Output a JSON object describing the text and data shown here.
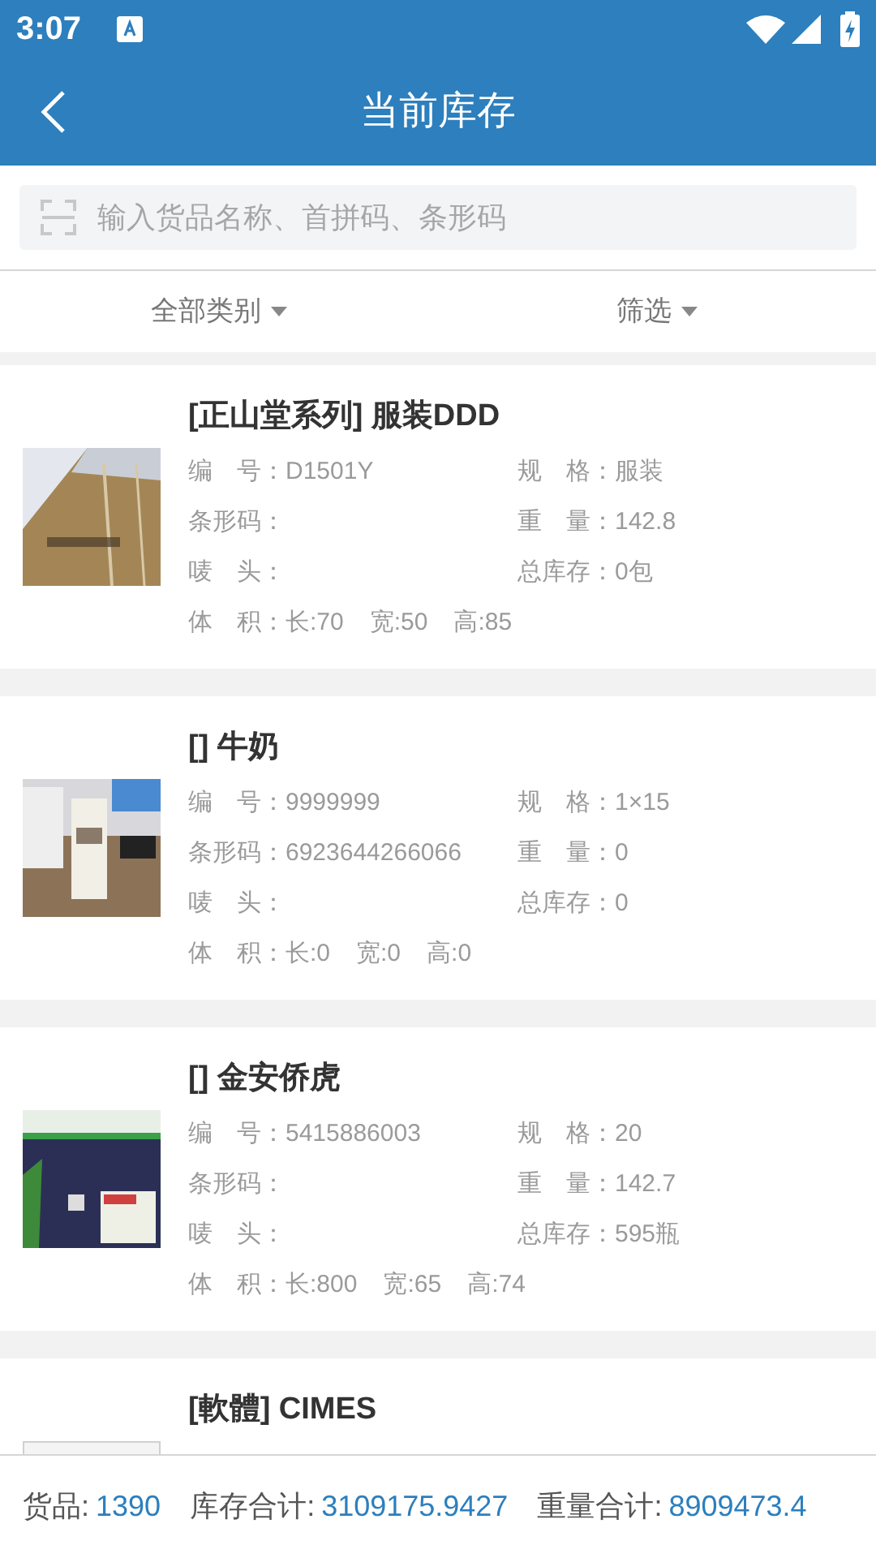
{
  "status_bar": {
    "time": "3:07"
  },
  "header": {
    "title": "当前库存"
  },
  "search": {
    "placeholder": "输入货品名称、首拼码、条形码"
  },
  "filters": [
    {
      "label": "全部类别"
    },
    {
      "label": "筛选"
    }
  ],
  "items": [
    {
      "kind": "picture",
      "title": "[正山堂系列] 服装DDD",
      "rows": [
        [
          {
            "label": "编　号：",
            "value": "D1501Y"
          },
          {
            "label": "规　格：",
            "value": "服装"
          }
        ],
        [
          {
            "label": "条形码："
          },
          {
            "label": "重　量：",
            "value": "142.8"
          }
        ],
        [
          {
            "label": "唛　头："
          },
          {
            "label": "总库存：",
            "value": "0包"
          }
        ]
      ],
      "volume": {
        "label": "体　积：",
        "parts": [
          "长:70",
          "宽:50",
          "高:85"
        ]
      }
    },
    {
      "kind": "picture",
      "title": "[] 牛奶",
      "rows": [
        [
          {
            "label": "编　号：",
            "value": "9999999"
          },
          {
            "label": "规　格：",
            "value": "1×15"
          }
        ],
        [
          {
            "label": "条形码：",
            "value": "6923644266066"
          },
          {
            "label": "重　量：",
            "value": "0"
          }
        ],
        [
          {
            "label": "唛　头："
          },
          {
            "label": "总库存：",
            "value": "0"
          }
        ]
      ],
      "volume": {
        "label": "体　积：",
        "parts": [
          "长:0",
          "宽:0",
          "高:0"
        ]
      }
    },
    {
      "kind": "picture",
      "title": "[] 金安侨虎",
      "rows": [
        [
          {
            "label": "编　号：",
            "value": "5415886003"
          },
          {
            "label": "规　格：",
            "value": "20"
          }
        ],
        [
          {
            "label": "条形码："
          },
          {
            "label": "重　量：",
            "value": "142.7"
          }
        ],
        [
          {
            "label": "唛　头："
          },
          {
            "label": "总库存：",
            "value": "595瓶"
          }
        ]
      ],
      "volume": {
        "label": "体　积：",
        "parts": [
          "长:800",
          "宽:65",
          "高:74"
        ]
      }
    },
    {
      "kind": "placeholder",
      "title": "[軟體] CIMES"
    }
  ],
  "summary": [
    {
      "label": "货品:",
      "value": "1390"
    },
    {
      "label": "库存合计:",
      "value": "3109175.9427"
    },
    {
      "label": "重量合计:",
      "value": "8909473.4"
    }
  ]
}
